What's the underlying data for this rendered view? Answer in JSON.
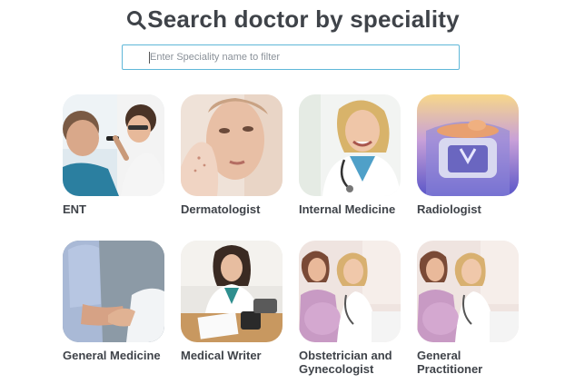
{
  "header": {
    "title": "Search doctor by speciality",
    "icon": "search-icon"
  },
  "search": {
    "placeholder": "Enter Speciality name to filter",
    "value": ""
  },
  "specialities": [
    {
      "label": "ENT",
      "image": "ent-doctor-examining-ear"
    },
    {
      "label": "Dermatologist",
      "image": "woman-skin-care-face"
    },
    {
      "label": "Internal Medicine",
      "image": "smiling-female-doctor-stethoscope"
    },
    {
      "label": "Radiologist",
      "image": "x-ray-scan-device"
    },
    {
      "label": "General Medicine",
      "image": "doctor-holding-patient-hand"
    },
    {
      "label": "Medical Writer",
      "image": "doctor-writing-at-desk"
    },
    {
      "label": "Obstetrician and\nGynecologist",
      "image": "doctor-with-pregnant-woman"
    },
    {
      "label": "General\nPractitioner",
      "image": "doctor-with-pregnant-woman"
    }
  ],
  "colors": {
    "text": "#3f4349",
    "search_border": "#5fb7d8"
  }
}
